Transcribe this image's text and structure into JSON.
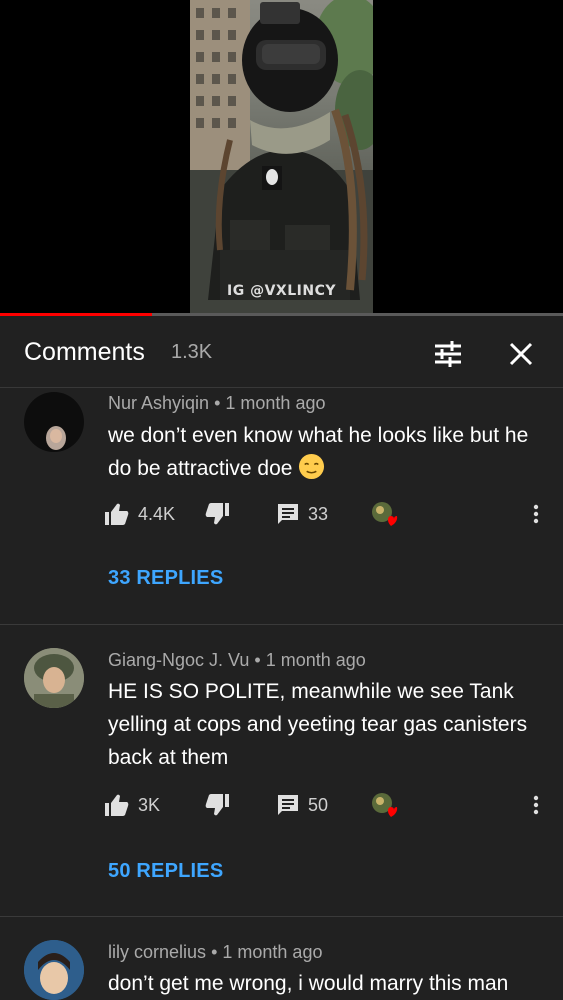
{
  "video": {
    "watermark": "IG @VXLINCY",
    "progress_fraction": 0.27
  },
  "header": {
    "title": "Comments",
    "count": "1.3K",
    "filter_icon": "tune-icon",
    "close_icon": "close-icon"
  },
  "comments": [
    {
      "author": "Nur Ashyiqin",
      "separator": "•",
      "time": "1 month ago",
      "text": "we don’t even know what he looks like but he do be attractive doe",
      "emoji": "relieved-face-emoji",
      "likes": "4.4K",
      "reply_count": "33",
      "replies_label": "33 REPLIES"
    },
    {
      "author": "Giang-Ngoc J. Vu",
      "separator": "•",
      "time": "1 month ago",
      "text": "HE IS SO POLITE, meanwhile we see Tank yelling at cops and yeeting tear gas canisters back at them",
      "likes": "3K",
      "reply_count": "50",
      "replies_label": "50 REPLIES"
    },
    {
      "author": "lily cornelius",
      "separator": "•",
      "time": "1 month ago",
      "text": "don’t get me wrong, i would marry this man"
    }
  ],
  "colors": {
    "background": "#212121",
    "link_blue": "#3ea6ff",
    "progress_red": "#ff0000",
    "meta_gray": "#aaaaaa"
  }
}
